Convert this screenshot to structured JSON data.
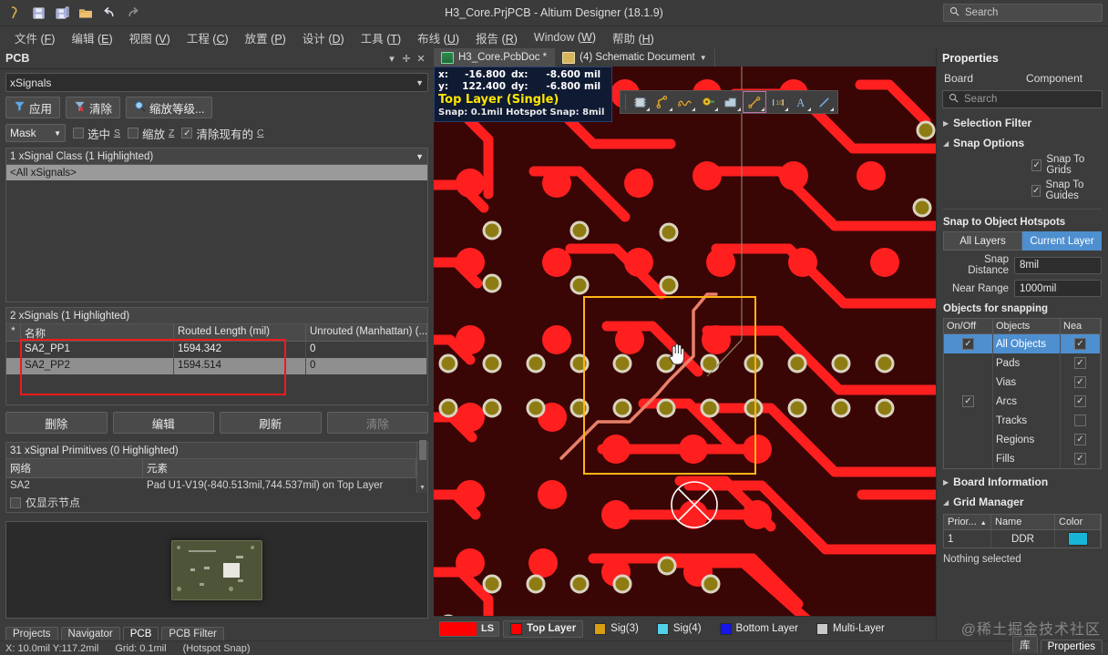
{
  "window": {
    "title": "H3_Core.PrjPCB - Altium Designer (18.1.9)",
    "search_placeholder": "Search",
    "quick_access": [
      "altium-logo-icon",
      "save-icon",
      "save-all-icon",
      "open-folder-icon",
      "undo-icon",
      "redo-icon"
    ]
  },
  "menu": [
    {
      "label": "文件",
      "accel": "F"
    },
    {
      "label": "编辑",
      "accel": "E"
    },
    {
      "label": "视图",
      "accel": "V"
    },
    {
      "label": "工程",
      "accel": "C"
    },
    {
      "label": "放置",
      "accel": "P"
    },
    {
      "label": "设计",
      "accel": "D"
    },
    {
      "label": "工具",
      "accel": "T"
    },
    {
      "label": "布线",
      "accel": "U"
    },
    {
      "label": "报告",
      "accel": "R"
    },
    {
      "label": "Window",
      "accel": "W"
    },
    {
      "label": "帮助",
      "accel": "H"
    }
  ],
  "pcb_panel": {
    "title": "PCB",
    "scope_combo": "xSignals",
    "buttons": {
      "apply": "应用",
      "clear": "清除",
      "zoom_level": "缩放等级...",
      "delete": "删除",
      "edit": "编辑",
      "refresh": "刷新",
      "clear2": "清除"
    },
    "mask_combo": "Mask",
    "checks": [
      {
        "label": "选中",
        "accel": "S",
        "checked": false
      },
      {
        "label": "缩放",
        "accel": "Z",
        "checked": false
      },
      {
        "label": "清除现有的",
        "accel": "C",
        "checked": true
      }
    ],
    "class_caption": "1 xSignal Class (1 Highlighted)",
    "class_items": [
      "<All xSignals>"
    ],
    "signals_caption": "2 xSignals (1 Highlighted)",
    "signals_columns": [
      "*",
      "名称",
      "Routed Length (mil)",
      "Unrouted (Manhattan) (..."
    ],
    "signals_rows": [
      {
        "mark": "",
        "name": "SA2_PP1",
        "routed": "1594.342",
        "unrouted": "0",
        "selected": false
      },
      {
        "mark": "",
        "name": "SA2_PP2",
        "routed": "1594.514",
        "unrouted": "0",
        "selected": true
      }
    ],
    "primitives_caption": "31 xSignal Primitives (0 Highlighted)",
    "primitives_columns": [
      "网络",
      "元素"
    ],
    "primitives_rows": [
      {
        "net": "SA2",
        "element": "Pad U1-V19(-840.513mil,744.537mil) on Top Layer"
      }
    ],
    "show_nodes_only": {
      "label": "仅显示节点",
      "checked": false
    },
    "tabs": [
      {
        "label": "Projects",
        "active": false
      },
      {
        "label": "Navigator",
        "active": false
      },
      {
        "label": "PCB",
        "active": true
      },
      {
        "label": "PCB Filter",
        "active": false
      }
    ]
  },
  "editor": {
    "doc_tabs": [
      {
        "label": "H3_Core.PcbDoc *",
        "active": true,
        "icon": "pcb-doc-icon"
      },
      {
        "label": "(4) Schematic Document",
        "active": false,
        "icon": "sch-doc-icon"
      }
    ],
    "coords": {
      "x_key": "x:",
      "x_val": "-16.800",
      "dx_key": "dx:",
      "dx_val": "-8.600",
      "x_unit": "mil",
      "y_key": "y:",
      "y_val": "122.400",
      "dy_key": "dy:",
      "dy_val": "-6.800",
      "y_unit": "mil",
      "layer": "Top Layer (Single)",
      "snap": "Snap: 0.1mil Hotspot Snap: 8mil"
    },
    "toolbar_icons": [
      "component-icon",
      "route-net-icon",
      "differential-pair-route-icon",
      "via-icon",
      "polygon-pour-icon",
      "interactive-length-tuning-icon",
      "dimension-icon",
      "string-icon",
      "line-icon"
    ],
    "layer_tabs": [
      {
        "label": "LS",
        "color": "#ff0000",
        "type": "swatchbar"
      },
      {
        "label": "Top Layer",
        "color": "#ff0000",
        "active": true
      },
      {
        "label": "Sig(3)",
        "color": "#d99e12",
        "active": false
      },
      {
        "label": "Sig(4)",
        "color": "#4fd2e8",
        "active": false
      },
      {
        "label": "Bottom Layer",
        "color": "#1616e8",
        "active": false
      },
      {
        "label": "Multi-Layer",
        "color": "#c8c8c8",
        "active": false
      }
    ]
  },
  "properties": {
    "title": "Properties",
    "tabs": [
      "Board",
      "Component"
    ],
    "search_placeholder": "Search",
    "sections": {
      "selection_filter": {
        "label": "Selection Filter",
        "expanded": false
      },
      "snap_options": {
        "label": "Snap Options",
        "expanded": true
      },
      "board_information": {
        "label": "Board Information",
        "expanded": false
      },
      "grid_manager": {
        "label": "Grid Manager",
        "expanded": true
      }
    },
    "snap_checks": [
      {
        "label": "Snap To Grids",
        "checked": true
      },
      {
        "label": "Snap To Guides",
        "checked": true
      }
    ],
    "hotspots_label": "Snap to Object Hotspots",
    "layer_segments": [
      {
        "label": "All Layers",
        "on": false
      },
      {
        "label": "Current Layer",
        "on": true
      }
    ],
    "fields": [
      {
        "label": "Snap Distance",
        "value": "8mil"
      },
      {
        "label": "Near Range",
        "value": "1000mil"
      }
    ],
    "objects_label": "Objects for snapping",
    "objects_columns": [
      "On/Off",
      "Objects",
      "Nea"
    ],
    "objects_rows": [
      {
        "on": true,
        "name": "All Objects",
        "near": true,
        "selected": true
      },
      {
        "on": false,
        "name": "Pads",
        "near": true,
        "selected": false
      },
      {
        "on": false,
        "name": "Vias",
        "near": true,
        "selected": false
      },
      {
        "on": true,
        "name": "Arcs",
        "near": true,
        "selected": false
      },
      {
        "on": false,
        "name": "Tracks",
        "near": false,
        "selected": false
      },
      {
        "on": false,
        "name": "Regions",
        "near": true,
        "selected": false
      },
      {
        "on": false,
        "name": "Fills",
        "near": true,
        "selected": false
      }
    ],
    "grid_columns": [
      "Prior...",
      "Name",
      "Color"
    ],
    "grid_rows": [
      {
        "priority": "1",
        "name": "DDR",
        "color": "#17b6d8"
      }
    ],
    "status": "Nothing selected",
    "bottom_tabs": [
      {
        "label": "库",
        "active": false
      },
      {
        "label": "Properties",
        "active": true
      }
    ]
  },
  "statusbar": {
    "coords": "X: 10.0mil Y:117.2mil",
    "grid": "Grid: 0.1mil",
    "hint": "(Hotspot Snap)"
  },
  "watermark": "@稀土掘金技术社区",
  "colors": {
    "accent": "#4e8fd0",
    "trace": "#ff2020",
    "pad_gold": "#8c7a12",
    "selection_rect": "#ffb515",
    "annotation_rect": "#f01a1a",
    "canvas_bg": "#3a0505"
  }
}
